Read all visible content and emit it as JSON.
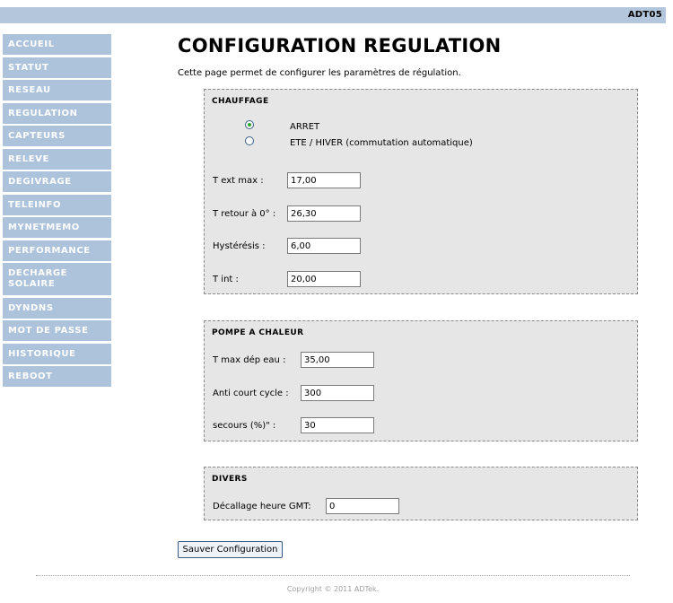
{
  "header": {
    "device_name": "ADT05"
  },
  "sidebar": {
    "items": [
      {
        "label": "ACCUEIL"
      },
      {
        "label": "STATUT"
      },
      {
        "label": "RESEAU"
      },
      {
        "label": "REGULATION"
      },
      {
        "label": "CAPTEURS"
      },
      {
        "label": "RELEVE"
      },
      {
        "label": "DEGIVRAGE"
      },
      {
        "label": "TELEINFO"
      },
      {
        "label": "MYNETMEMO"
      },
      {
        "label": "PERFORMANCE"
      },
      {
        "label": "DECHARGE SOLAIRE"
      },
      {
        "label": "DYNDNS"
      },
      {
        "label": "MOT DE PASSE"
      },
      {
        "label": "HISTORIQUE"
      },
      {
        "label": "REBOOT"
      }
    ]
  },
  "main": {
    "title": "CONFIGURATION REGULATION",
    "intro": "Cette page permet de configurer les paramètres de régulation."
  },
  "chauffage": {
    "legend": "CHAUFFAGE",
    "mode_options": [
      {
        "label": "ARRET",
        "checked": true
      },
      {
        "label": "ETE / HIVER (commutation automatique)",
        "checked": false
      }
    ],
    "fields": [
      {
        "label": "T ext max :",
        "value": "17,00"
      },
      {
        "label": "T retour à 0° :",
        "value": "26,30"
      },
      {
        "label": "Hystérésis :",
        "value": "6,00"
      },
      {
        "label": "T int :",
        "value": "20,00"
      }
    ]
  },
  "pompe": {
    "legend": "POMPE A CHALEUR",
    "fields": [
      {
        "label": "T max dép eau :",
        "value": "35,00"
      },
      {
        "label": "Anti court cycle :",
        "value": "300"
      },
      {
        "label": "secours (%)\" :",
        "value": "30"
      }
    ]
  },
  "divers": {
    "legend": "DIVERS",
    "fields": [
      {
        "label": "Décallage heure GMT:",
        "value": "0"
      }
    ]
  },
  "actions": {
    "save_label": "Sauver Configuration"
  },
  "footer": {
    "copyright": "Copyright © 2011 ADTek."
  }
}
